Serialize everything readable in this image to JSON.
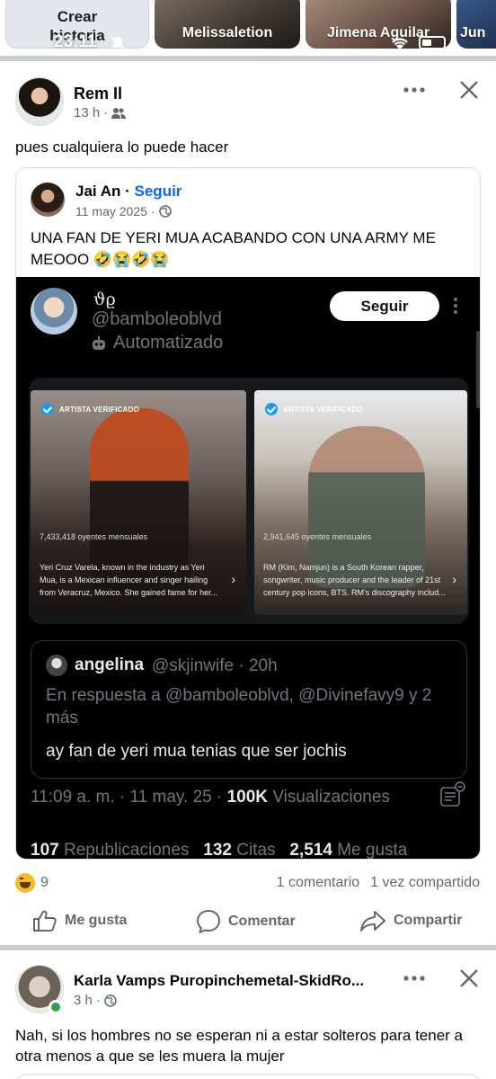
{
  "stories": {
    "create_label_line1": "Crear",
    "create_label_line2": "historia",
    "items": [
      {
        "name": "Melissaletion"
      },
      {
        "name": "Jimena Aguilar"
      },
      {
        "name": "Jun"
      }
    ]
  },
  "status_bar": {
    "time": "23:11"
  },
  "post1": {
    "author": "Rem Il",
    "time": "13 h",
    "audience_icon": "friends-icon",
    "text": "pues cualquiera lo puede hacer",
    "shared": {
      "author": "Jai An",
      "follow_label": "Seguir",
      "date": "11 may 2025",
      "audience_icon": "globe-icon",
      "text": "UNA FAN DE YERI MUA ACABANDO CON UNA ARMY ME MEOOO 🤣😭🤣😭",
      "tweet": {
        "display_name": "ϑϱ",
        "handle": "@bamboleoblvd",
        "automated_label": "Automatizado",
        "follow_label": "Seguir",
        "cards": [
          {
            "badge": "ARTISTA VERIFICADO",
            "listeners": "7,433,418 oyentes mensuales",
            "description": "Yeri Cruz Varela, known in the industry as Yeri Mua, is a Mexican influencer and singer hailing from Veracruz, Mexico. She gained fame for her..."
          },
          {
            "badge": "ARTISTA VERIFICADO",
            "listeners": "2,941,645 oyentes mensuales",
            "description": "RM (Kim, Namjun) is a South Korean rapper, songwriter, music producer and the leader of 21st century pop icons, BTS. RM's discography includ..."
          }
        ],
        "quote": {
          "name": "angelina",
          "handle_time": "@skjinwife · 20h",
          "reply_to": "En respuesta a @bamboleoblvd, @Divinefavy9 y 2 más",
          "text": "ay fan de yeri mua tenias que ser jochis"
        },
        "timestamp": "11:09 a. m. · 11 may. 25 ·",
        "views_count": "100K",
        "views_label": "Visualizaciones",
        "reposts_count": "107",
        "reposts_label": "Republicaciones",
        "quotes_count": "132",
        "quotes_label": "Citas",
        "likes_count": "2,514",
        "likes_label": "Me gusta"
      }
    },
    "reaction_count": "9",
    "comments": "1 comentario",
    "shares": "1 vez compartido",
    "actions": {
      "like": "Me gusta",
      "comment": "Comentar",
      "share": "Compartir"
    }
  },
  "post2": {
    "author": "Karla Vamps Puropinchemetal-SkidRo...",
    "time": "3 h",
    "audience_icon": "globe-icon",
    "text": "Nah, si los hombres no se esperan ni a estar solteros para tener a otra menos a que se les muera la mujer"
  },
  "colors": {
    "link_blue": "#0866ff",
    "secondary_text": "#65676b",
    "divider": "#c9ccd1",
    "tweet_bg": "#000000"
  }
}
